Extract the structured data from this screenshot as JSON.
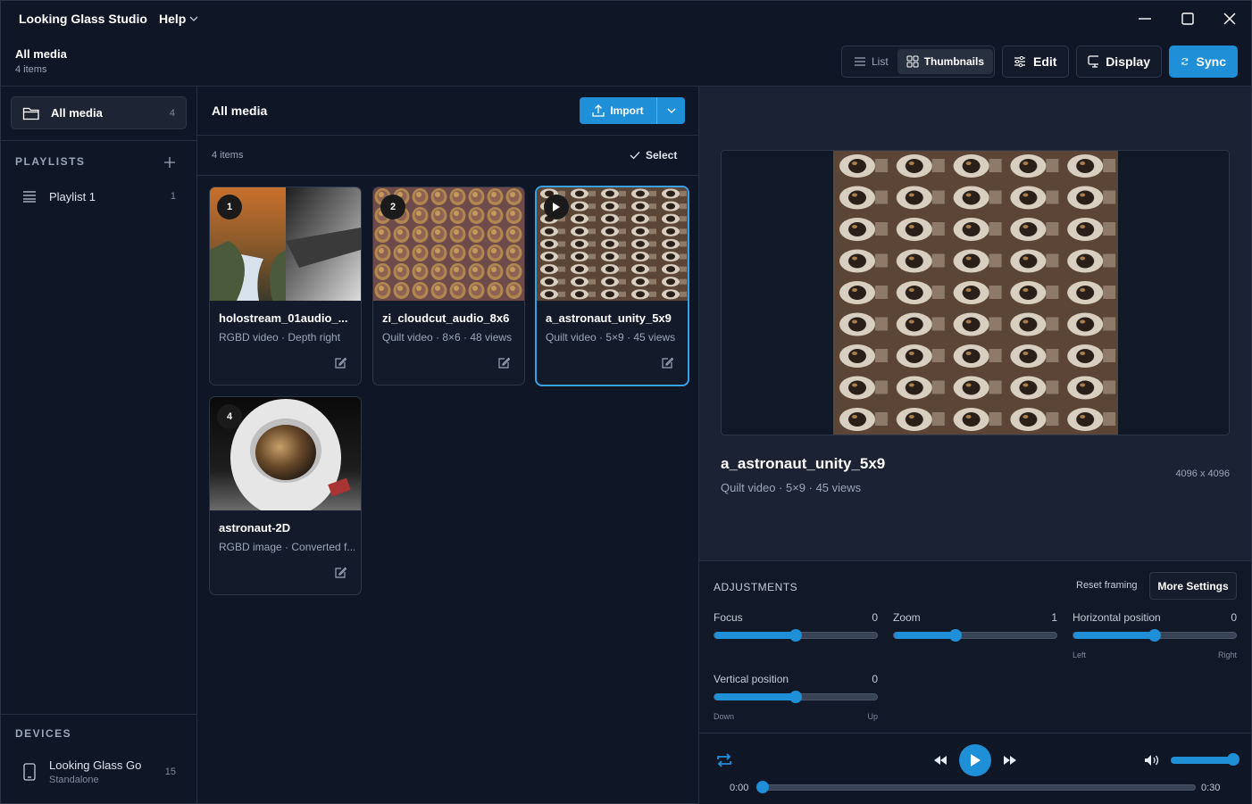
{
  "app": {
    "title": "Looking Glass Studio",
    "help_label": "Help"
  },
  "header": {
    "title": "All media",
    "subtitle": "4 items"
  },
  "view_toggle": {
    "list_label": "List",
    "thumbnails_label": "Thumbnails",
    "active": "Thumbnails"
  },
  "toolbar": {
    "edit_label": "Edit",
    "display_label": "Display",
    "sync_label": "Sync"
  },
  "sidebar": {
    "all_media": {
      "label": "All media",
      "count": "4"
    },
    "playlists_label": "PLAYLISTS",
    "playlists": [
      {
        "label": "Playlist 1",
        "count": "1"
      }
    ],
    "devices_label": "DEVICES",
    "devices": [
      {
        "name": "Looking Glass Go",
        "status": "Standalone",
        "count": "15"
      }
    ]
  },
  "library": {
    "title": "All media",
    "import_label": "Import",
    "count_label": "4 items",
    "select_label": "Select",
    "items": [
      {
        "badge": "1",
        "name": "holostream_01audio_...",
        "meta": "RGBD video · Depth right"
      },
      {
        "badge": "2",
        "name": "zi_cloudcut_audio_8x6",
        "meta": "Quilt video · 8×6 · 48 views"
      },
      {
        "badge": "play",
        "name": "a_astronaut_unity_5x9",
        "meta": "Quilt video · 5×9 · 45 views",
        "selected": true
      },
      {
        "badge": "4",
        "name": "astronaut-2D",
        "meta": "RGBD image · Converted f..."
      }
    ]
  },
  "preview": {
    "title": "a_astronaut_unity_5x9",
    "meta": "Quilt video · 5×9 · 45 views",
    "resolution": "4096 x 4096"
  },
  "adjustments": {
    "label": "ADJUSTMENTS",
    "reset_label": "Reset framing",
    "more_label": "More Settings",
    "sliders": [
      {
        "label": "Focus",
        "value": "0",
        "level": 0.5
      },
      {
        "label": "Zoom",
        "value": "1",
        "level": 0.38
      },
      {
        "label": "Horizontal position",
        "value": "0",
        "level": 0.5,
        "min_label": "Left",
        "max_label": "Right"
      },
      {
        "label": "Vertical position",
        "value": "0",
        "level": 0.5,
        "min_label": "Down",
        "max_label": "Up"
      }
    ]
  },
  "player": {
    "current_time": "0:00",
    "duration": "0:30",
    "progress": 0,
    "volume": 1.0
  },
  "colors": {
    "accent": "#1f8fd8",
    "background": "#0f1626",
    "panel": "#1a2233"
  }
}
